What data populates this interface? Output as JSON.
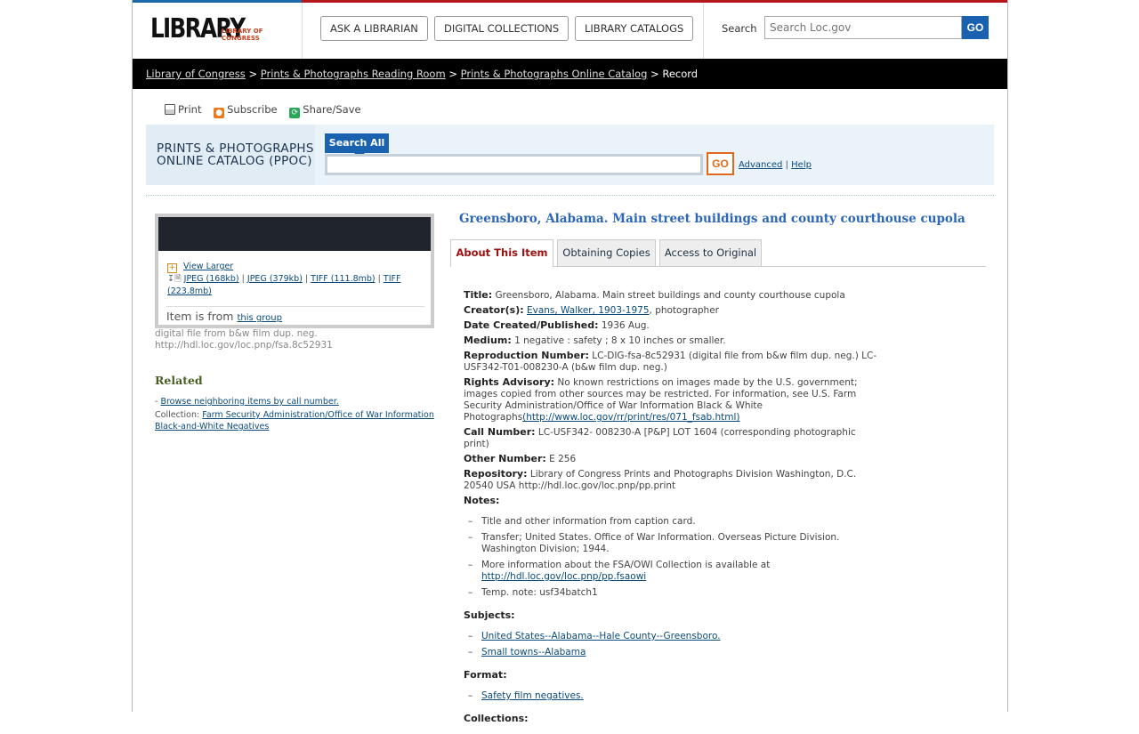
{
  "header": {
    "logo_main": "LIBRARY",
    "logo_sub": "LIBRARY OF CONGRESS",
    "nav": [
      "ASK A LIBRARIAN",
      "DIGITAL COLLECTIONS",
      "LIBRARY CATALOGS"
    ],
    "search_label": "Search",
    "search_placeholder": "Search Loc.gov",
    "search_go": "GO"
  },
  "breadcrumb": {
    "items": [
      "Library of Congress",
      "Prints & Photographs Reading Room",
      "Prints & Photographs Online Catalog"
    ],
    "sep": ">",
    "current": "Record"
  },
  "tools": {
    "print": "Print",
    "subscribe": "Subscribe",
    "share": "Share/Save"
  },
  "ppoc": {
    "title_line1": "PRINTS & PHOTOGRAPHS",
    "title_line2": "ONLINE CATALOG (PPOC)",
    "tab": "Search All",
    "go": "GO",
    "advanced": "Advanced",
    "sep": "|",
    "help": "Help"
  },
  "thumb": {
    "view_larger": "View Larger",
    "files": [
      "JPEG (168kb)",
      "JPEG (379kb)",
      "TIFF (111.8mb)",
      "TIFF (223.8mb)"
    ],
    "file_sep": "|",
    "item_from": "Item is from",
    "group_link": "this group",
    "caption1": "digital file from b&w film dup. neg.",
    "caption2": "http://hdl.loc.gov/loc.pnp/fsa.8c52931"
  },
  "related": {
    "heading": "Related",
    "browse_prefix": "-",
    "browse": "Browse neighboring items by call number.",
    "collection_label": "Collection:",
    "collection_link": "Farm Security Administration/Office of War Information Black-and-White Negatives"
  },
  "record": {
    "title": "Greensboro, Alabama. Main street buildings and county courthouse cupola",
    "tabs": [
      "About This Item",
      "Obtaining Copies",
      "Access to Original"
    ],
    "fields": {
      "title_label": "Title:",
      "title_value": "Greensboro, Alabama. Main street buildings and county courthouse cupola",
      "creator_label": "Creator(s):",
      "creator_link": "Evans, Walker, 1903-1975",
      "creator_role": ", photographer",
      "date_label": "Date Created/Published:",
      "date_value": "1936 Aug.",
      "medium_label": "Medium:",
      "medium_value": "1 negative : safety ; 8 x 10 inches or smaller.",
      "repro_label": "Reproduction Number:",
      "repro_value": "LC-DIG-fsa-8c52931 (digital file from b&w film dup. neg.) LC-USF342-T01-008230-A (b&w film dup. neg.)",
      "rights_label": "Rights Advisory:",
      "rights_value": "No known restrictions on images made by the U.S. government; images copied from other sources may be restricted. For information, see U.S. Farm Security Administration/Office of War Information Black & White Photographs",
      "rights_link": "(http://www.loc.gov/rr/print/res/071_fsab.html)",
      "call_label": "Call Number:",
      "call_value": "LC-USF342- 008230-A [P&P] LOT 1604 (corresponding photographic print)",
      "other_label": "Other Number:",
      "other_value": "E 256",
      "repo_label": "Repository:",
      "repo_value": "Library of Congress Prints and Photographs Division Washington, D.C. 20540 USA http://hdl.loc.gov/loc.pnp/pp.print"
    },
    "notes_heading": "Notes:",
    "notes": [
      "Title and other information from caption card.",
      "Transfer; United States. Office of War Information. Overseas Picture Division. Washington Division; 1944.",
      "More information about the FSA/OWI Collection is available at",
      "Temp. note: usf34batch1"
    ],
    "notes_link": "http://hdl.loc.gov/loc.pnp/pp.fsaowi",
    "subjects_heading": "Subjects:",
    "subjects": [
      "United States--Alabama--Hale County--Greensboro.",
      "Small towns--Alabama"
    ],
    "format_heading": "Format:",
    "format": [
      "Safety film negatives."
    ],
    "collections_heading": "Collections:"
  }
}
